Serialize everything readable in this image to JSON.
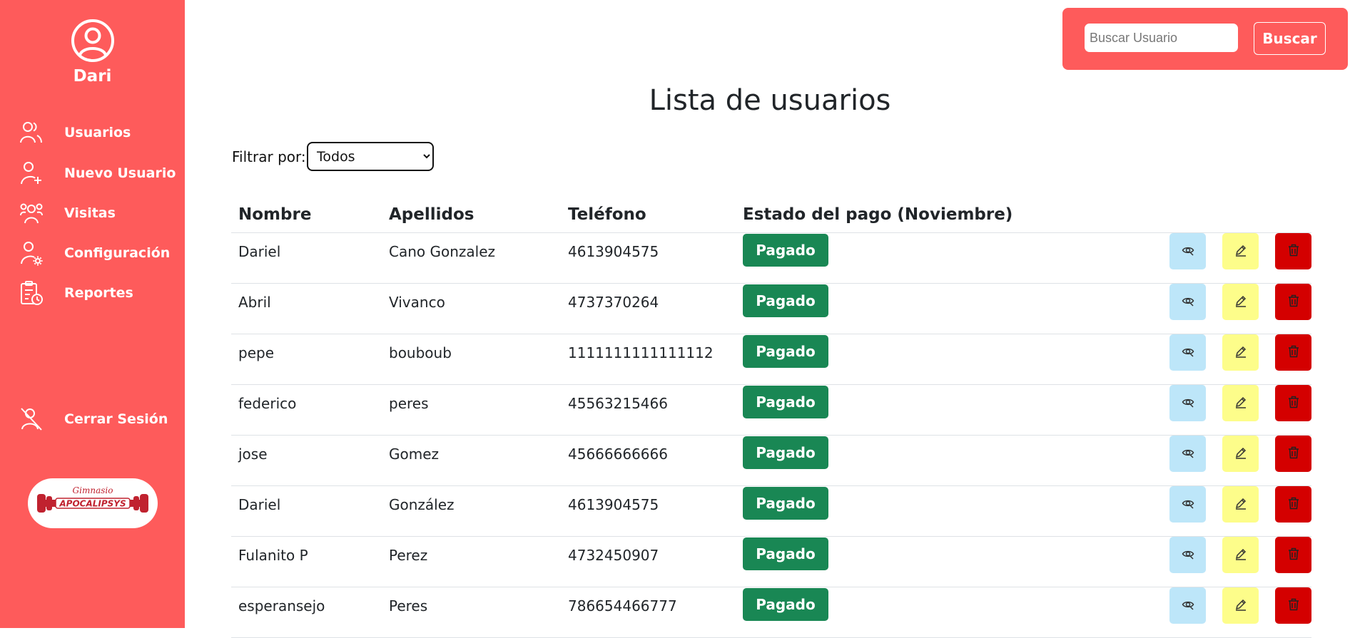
{
  "sidebar": {
    "username": "Dari",
    "items": [
      {
        "label": "Usuarios",
        "icon": "users-icon"
      },
      {
        "label": "Nuevo Usuario",
        "icon": "user-plus-icon"
      },
      {
        "label": "Visitas",
        "icon": "group-icon"
      },
      {
        "label": "Configuración",
        "icon": "user-gear-icon"
      },
      {
        "label": "Reportes",
        "icon": "clipboard-clock-icon"
      }
    ],
    "logout_label": "Cerrar Sesión",
    "logo": {
      "script_text": "Gimnasio",
      "brand_text": "APOCALIPSYS"
    }
  },
  "search": {
    "placeholder": "Buscar Usuario",
    "value": "",
    "button_label": "Buscar"
  },
  "main": {
    "title": "Lista de usuarios",
    "filter": {
      "label": "Filtrar por:",
      "selected": "Todos"
    },
    "table": {
      "headers": [
        "Nombre",
        "Apellidos",
        "Teléfono",
        "Estado del pago (Noviembre)"
      ],
      "rows": [
        {
          "nombre": "Dariel",
          "apellidos": "Cano Gonzalez",
          "telefono": "4613904575",
          "estado": "Pagado"
        },
        {
          "nombre": "Abril",
          "apellidos": "Vivanco",
          "telefono": "4737370264",
          "estado": "Pagado"
        },
        {
          "nombre": "pepe",
          "apellidos": "bouboub",
          "telefono": "1111111111111112",
          "estado": "Pagado"
        },
        {
          "nombre": "federico",
          "apellidos": "peres",
          "telefono": "45563215466",
          "estado": "Pagado"
        },
        {
          "nombre": "jose",
          "apellidos": "Gomez",
          "telefono": "45666666666",
          "estado": "Pagado"
        },
        {
          "nombre": "Dariel",
          "apellidos": "González",
          "telefono": "4613904575",
          "estado": "Pagado"
        },
        {
          "nombre": "Fulanito P",
          "apellidos": "Perez",
          "telefono": "4732450907",
          "estado": "Pagado"
        },
        {
          "nombre": "esperansejo",
          "apellidos": "Peres",
          "telefono": "786654466777",
          "estado": "Pagado"
        }
      ]
    }
  },
  "colors": {
    "sidebar_bg": "#fe5b5b",
    "paid_badge": "#198754",
    "view_button": "#bde6f9",
    "edit_button": "#fdfd8a",
    "delete_button": "#d40000"
  }
}
